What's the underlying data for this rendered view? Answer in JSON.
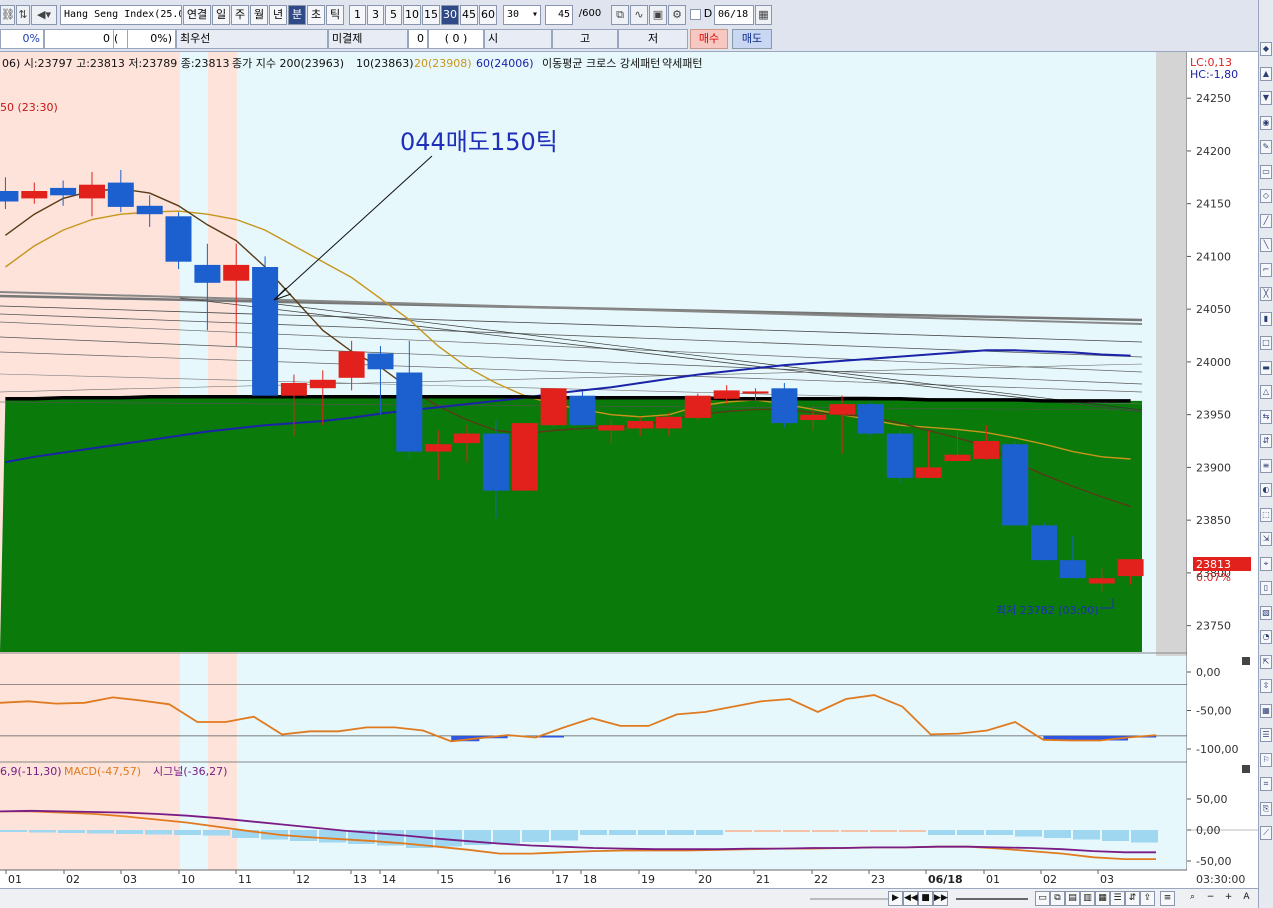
{
  "toolbar": {
    "symbol": "Hang Seng Index(25.0",
    "periods": [
      "연결",
      "일",
      "주",
      "월",
      "년",
      "분",
      "초",
      "틱"
    ],
    "active_period": "분",
    "intervals": [
      "1",
      "3",
      "5",
      "10",
      "15",
      "30",
      "45",
      "60"
    ],
    "active_interval": "30",
    "interval_select": "30",
    "count_value": "45",
    "count_max": "/600",
    "date_checkbox_label": "D",
    "date_value": "06/18"
  },
  "quote_bar": {
    "change_pct": "0%",
    "volume": "0",
    "volume_paren": "(",
    "volume_pct": "0%)",
    "best_bid_label": "최우선",
    "open_interest_label": "미결제",
    "open_interest_value": "0",
    "open_interest_change": "( 0 )",
    "open_label": "시",
    "high_label": "고",
    "low_label": "저",
    "buy_label": "매수",
    "sell_label": "매도"
  },
  "legend": {
    "ohlc": "06) 시:23797 고:23813 저:23789 종:23813",
    "ma_label": "종가 지수 200(23963)",
    "ma10": "10(23863)",
    "ma20": "20(23908)",
    "ma60": "60(24006)",
    "cross_label": "이동평균 크로스 강세패턴",
    "weak_label": "약세패턴",
    "lc": "LC:0,13",
    "hc": "HC:-1,80",
    "top_left_note": "50 (23:30)"
  },
  "annotation": {
    "text": "044매도150틱",
    "low_text": "최저 23782 (03:00)"
  },
  "current_price": {
    "value": "23813",
    "pct": "0.07%"
  },
  "colors": {
    "up": "#e3211c",
    "down": "#1c5fcf",
    "ma_black": "#000000",
    "ma_navy": "#1b23a8",
    "ma_gold": "#c8951b",
    "ma_brown": "#5a3a16",
    "green_fill": "#0a7a0a",
    "bg_light": "#e6f8fc",
    "session_pink": "#fde3da",
    "osc_orange": "#e07a1f",
    "macd_purple": "#7a1c86",
    "hist_blue": "#9fd6f0"
  },
  "chart_data": {
    "type": "candlestick",
    "y_ticks": [
      24250,
      24200,
      24150,
      24100,
      24050,
      24000,
      23950,
      23900,
      23850,
      23800,
      23750
    ],
    "ylim": [
      23725,
      24290
    ],
    "x_labels": [
      "01",
      "02",
      "03",
      "10",
      "11",
      "12",
      "13",
      "14",
      "15",
      "16",
      "17",
      "18",
      "19",
      "20",
      "21",
      "22",
      "23",
      "06/18",
      "01",
      "02",
      "03"
    ],
    "time_axis_right": "03:30:00",
    "candles": [
      {
        "o": 24162,
        "h": 24175,
        "l": 24145,
        "c": 24152
      },
      {
        "o": 24155,
        "h": 24170,
        "l": 24150,
        "c": 24162
      },
      {
        "o": 24165,
        "h": 24172,
        "l": 24148,
        "c": 24158
      },
      {
        "o": 24155,
        "h": 24180,
        "l": 24138,
        "c": 24168
      },
      {
        "o": 24170,
        "h": 24182,
        "l": 24142,
        "c": 24147
      },
      {
        "o": 24148,
        "h": 24158,
        "l": 24128,
        "c": 24140
      },
      {
        "o": 24138,
        "h": 24142,
        "l": 24088,
        "c": 24095
      },
      {
        "o": 24092,
        "h": 24112,
        "l": 24030,
        "c": 24075
      },
      {
        "o": 24077,
        "h": 24112,
        "l": 24015,
        "c": 24092
      },
      {
        "o": 24090,
        "h": 24100,
        "l": 23968,
        "c": 23968
      },
      {
        "o": 23968,
        "h": 23988,
        "l": 23930,
        "c": 23980
      },
      {
        "o": 23975,
        "h": 23992,
        "l": 23940,
        "c": 23983
      },
      {
        "o": 23985,
        "h": 24020,
        "l": 23973,
        "c": 24010
      },
      {
        "o": 24008,
        "h": 24015,
        "l": 23950,
        "c": 23993
      },
      {
        "o": 23990,
        "h": 24020,
        "l": 23908,
        "c": 23915
      },
      {
        "o": 23915,
        "h": 23935,
        "l": 23888,
        "c": 23922
      },
      {
        "o": 23923,
        "h": 23940,
        "l": 23905,
        "c": 23932
      },
      {
        "o": 23932,
        "h": 23945,
        "l": 23852,
        "c": 23878
      },
      {
        "o": 23878,
        "h": 23942,
        "l": 23878,
        "c": 23942
      },
      {
        "o": 23940,
        "h": 23975,
        "l": 23938,
        "c": 23975
      },
      {
        "o": 23968,
        "h": 23972,
        "l": 23940,
        "c": 23940
      },
      {
        "o": 23935,
        "h": 23945,
        "l": 23923,
        "c": 23940
      },
      {
        "o": 23937,
        "h": 23948,
        "l": 23930,
        "c": 23944
      },
      {
        "o": 23937,
        "h": 23952,
        "l": 23930,
        "c": 23948
      },
      {
        "o": 23947,
        "h": 23970,
        "l": 23945,
        "c": 23968
      },
      {
        "o": 23965,
        "h": 23978,
        "l": 23960,
        "c": 23973
      },
      {
        "o": 23970,
        "h": 23975,
        "l": 23963,
        "c": 23972
      },
      {
        "o": 23975,
        "h": 23980,
        "l": 23938,
        "c": 23942
      },
      {
        "o": 23945,
        "h": 23958,
        "l": 23935,
        "c": 23950
      },
      {
        "o": 23950,
        "h": 23968,
        "l": 23913,
        "c": 23960
      },
      {
        "o": 23960,
        "h": 23962,
        "l": 23930,
        "c": 23932
      },
      {
        "o": 23932,
        "h": 23935,
        "l": 23885,
        "c": 23890
      },
      {
        "o": 23890,
        "h": 23935,
        "l": 23890,
        "c": 23900
      },
      {
        "o": 23906,
        "h": 23935,
        "l": 23905,
        "c": 23912
      },
      {
        "o": 23908,
        "h": 23940,
        "l": 23907,
        "c": 23925
      },
      {
        "o": 23922,
        "h": 23925,
        "l": 23845,
        "c": 23845
      },
      {
        "o": 23845,
        "h": 23848,
        "l": 23812,
        "c": 23812
      },
      {
        "o": 23812,
        "h": 23835,
        "l": 23795,
        "c": 23795
      },
      {
        "o": 23790,
        "h": 23805,
        "l": 23782,
        "c": 23795
      },
      {
        "o": 23797,
        "h": 23813,
        "l": 23789,
        "c": 23813
      }
    ],
    "ma_values": {
      "ma200": [
        23965,
        23965,
        23966,
        23966,
        23966,
        23967,
        23967,
        23967,
        23967,
        23967,
        23967,
        23967,
        23967,
        23967,
        23967,
        23967,
        23967,
        23967,
        23967,
        23966,
        23966,
        23966,
        23966,
        23966,
        23966,
        23965,
        23965,
        23965,
        23965,
        23965,
        23965,
        23965,
        23964,
        23964,
        23964,
        23964,
        23963,
        23963,
        23963,
        23963
      ],
      "ma60": [
        23905,
        23910,
        23914,
        23918,
        23922,
        23926,
        23930,
        23934,
        23937,
        23940,
        23942,
        23944,
        23947,
        23951,
        23954,
        23957,
        23960,
        23963,
        23966,
        23970,
        23973,
        23976,
        23980,
        23984,
        23988,
        23991,
        23994,
        23997,
        23999,
        24001,
        24003,
        24005,
        24007,
        24009,
        24011,
        24011,
        24010,
        24009,
        24007,
        24006
      ],
      "ma20": [
        24090,
        24110,
        24125,
        24135,
        24140,
        24142,
        24143,
        24140,
        24135,
        24125,
        24110,
        24095,
        24080,
        24060,
        24040,
        24015,
        23995,
        23980,
        23968,
        23960,
        23955,
        23950,
        23948,
        23950,
        23958,
        23962,
        23964,
        23960,
        23955,
        23950,
        23945,
        23940,
        23938,
        23936,
        23933,
        23928,
        23922,
        23915,
        23910,
        23908
      ],
      "ma10": [
        24120,
        24140,
        24155,
        24162,
        24164,
        24160,
        24148,
        24130,
        24115,
        24090,
        24060,
        24030,
        24010,
        23995,
        23975,
        23958,
        23945,
        23935,
        23932,
        23935,
        23937,
        23938,
        23940,
        23945,
        23950,
        23953,
        23955,
        23955,
        23952,
        23950,
        23948,
        23942,
        23935,
        23928,
        23920,
        23905,
        23893,
        23882,
        23872,
        23863
      ]
    },
    "oscillator_ticks": [
      "0,00",
      "-50,00",
      "-100,00"
    ],
    "macd_label": "6,9(-11,30)",
    "macd_value": "MACD(-47,57)",
    "signal_value": "시그널(-36,27)",
    "macd_ticks": [
      "50,00",
      "0,00",
      "-50,00"
    ]
  }
}
